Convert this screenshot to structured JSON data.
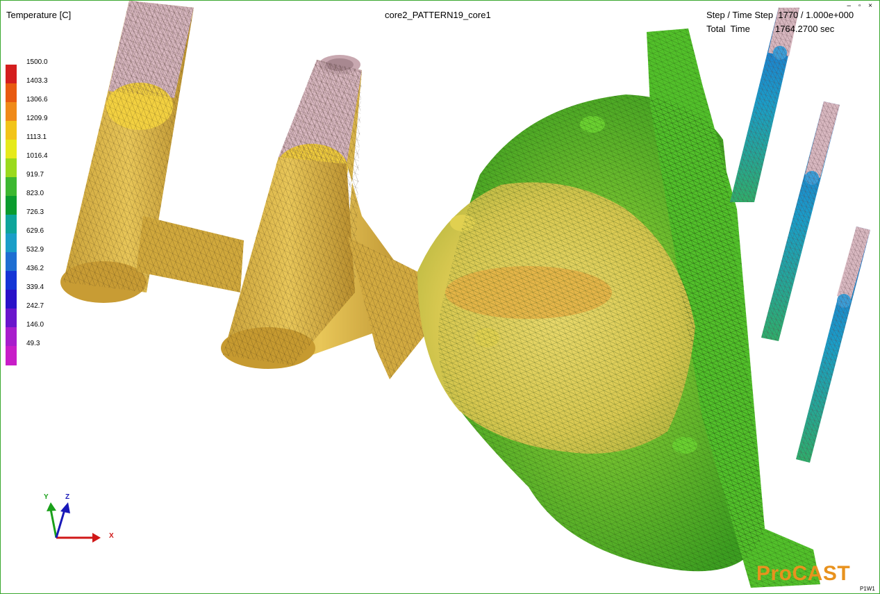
{
  "header": {
    "legend_title": "Temperature [C]",
    "sim_title": "core2_PATTERN19_core1",
    "step_line": "Step / Time Step  1770 / 1.000e+000",
    "time_line": "Total  Time          1764.2700 sec"
  },
  "legend": {
    "labels": [
      "1500.0",
      "1403.3",
      "1306.6",
      "1209.9",
      "1113.1",
      "1016.4",
      "919.7",
      "823.0",
      "726.3",
      "629.6",
      "532.9",
      "436.2",
      "339.4",
      "242.7",
      "146.0",
      "49.3"
    ],
    "colors": [
      "#d41e1e",
      "#e85a10",
      "#f08a18",
      "#f2c418",
      "#e6ea1a",
      "#9ada1c",
      "#3cb830",
      "#0a9c2e",
      "#0ea59a",
      "#1a9ec8",
      "#1e6ed2",
      "#1435d6",
      "#2a12c8",
      "#6a16cc",
      "#a81ecc",
      "#c81ec8"
    ]
  },
  "axes": {
    "y": "Y",
    "z": "Z",
    "x": "X"
  },
  "branding": {
    "logo": "ProCAST",
    "viewport_id": "P1W1"
  },
  "window_controls": "‒ ▫ ×",
  "colors": {
    "casting_green": "#5ec82a",
    "casting_yellow": "#d8d848",
    "feeder_tan": "#d9b445",
    "wire_pink": "#d8b8c0",
    "frame_border": "#3aa82e"
  }
}
